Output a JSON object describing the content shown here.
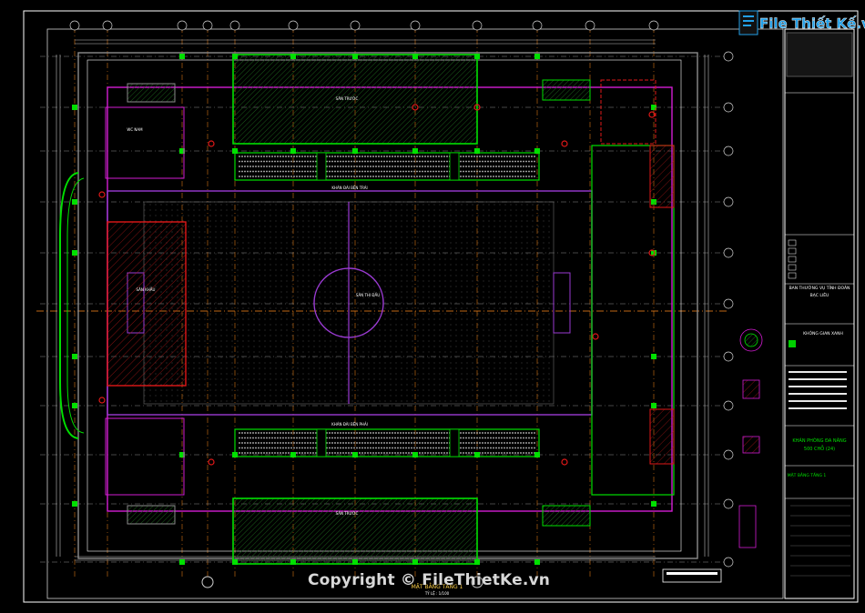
{
  "watermark": {
    "brand": "File Thiết Kế.vn",
    "copyright": "Copyright © FileThietKe.vn"
  },
  "title_block": {
    "owner_line1": "BAN THƯỜNG VỤ TỈNH ĐOÀN",
    "owner_line2": "BẠC LIÊU",
    "project_line1": "KHÁN PHÒNG ĐA NĂNG",
    "project_line2": "500 CHỖ (24)",
    "consultant": "KHÔNG GIAN XANH",
    "drawing_name": "MẶT BẰNG TẦNG 1"
  },
  "plan": {
    "title": "MẶT BẰNG TẦNG 1",
    "scale": "TỶ LỆ : 1/100",
    "left_stage_label": "SÂN KHẤU",
    "center_label": "SÂN THI ĐẤU",
    "court_top": "SÂN TRƯỚC",
    "court_bottom": "SÂN TRƯỚC",
    "stand_top": "KHÁN ĐÀI BÊN TRÁI",
    "stand_bottom": "KHÁN ĐÀI BÊN PHẢI",
    "wc_label": "WC NAM"
  },
  "colors": {
    "background": "#000000",
    "green": "#00e000",
    "magenta": "#d21cd2",
    "red": "#e01818",
    "orange": "#ff8c1a",
    "grey": "#8c8c8c",
    "white": "#ffffff",
    "brand_blue": "#22a0e8"
  }
}
